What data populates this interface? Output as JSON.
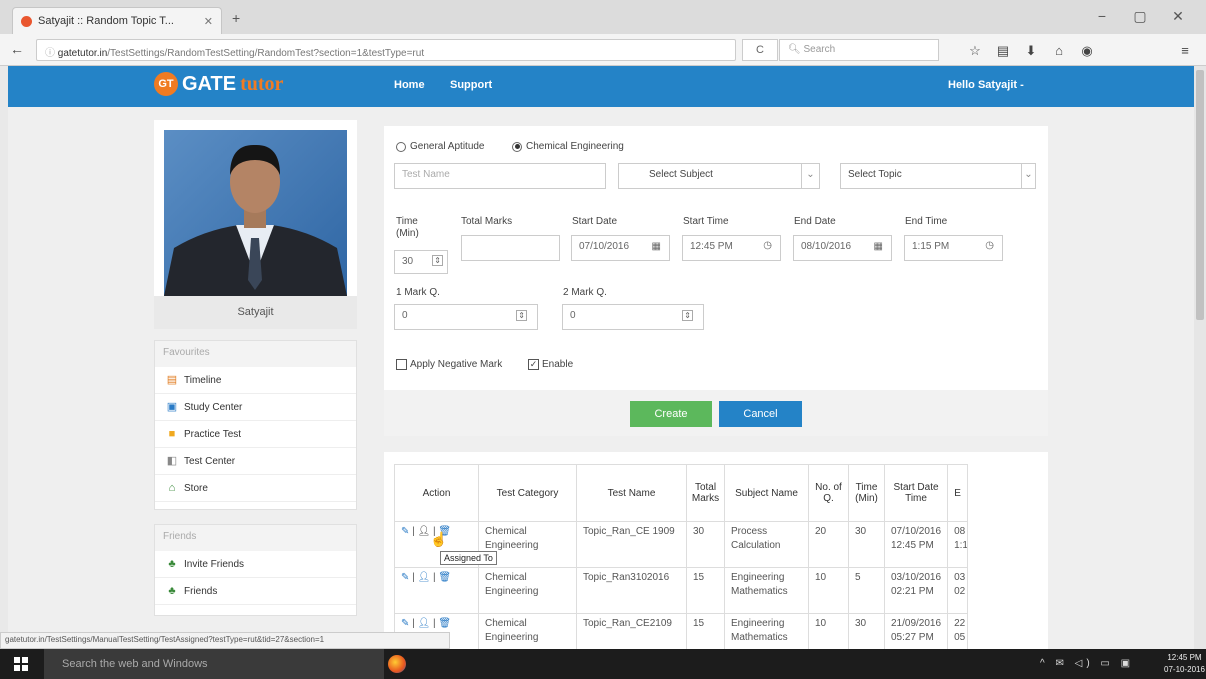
{
  "browser": {
    "tab_title": "Satyajit :: Random Topic T...",
    "tab_close": "✕",
    "new_tab": "+",
    "url_domain": "gatetutor.in",
    "url_path": "/TestSettings/RandomTestSetting/RandomTest?section=1&testType=rut",
    "reload": "C",
    "search_placeholder": "Search"
  },
  "site": {
    "logo_badge": "GT",
    "logo_gate": "GATE",
    "logo_tutor": "tutor",
    "nav_home": "Home",
    "nav_support": "Support",
    "greeting": "Hello Satyajit -"
  },
  "profile": {
    "name": "Satyajit"
  },
  "sidebar": {
    "favourites_title": "Favourites",
    "favourites": [
      {
        "label": "Timeline"
      },
      {
        "label": "Study Center"
      },
      {
        "label": "Practice Test"
      },
      {
        "label": "Test Center"
      },
      {
        "label": "Store"
      }
    ],
    "friends_title": "Friends",
    "friends": [
      {
        "label": "Invite Friends"
      },
      {
        "label": "Friends"
      }
    ]
  },
  "form": {
    "radio_general": "General Aptitude",
    "radio_chemical": "Chemical Engineering",
    "test_name_placeholder": "Test Name",
    "select_subject": "Select Subject",
    "select_topic": "Select Topic",
    "time_label": "Time (Min)",
    "time_value": "30",
    "total_marks_label": "Total Marks",
    "start_date_label": "Start Date",
    "start_date_value": "07/10/2016",
    "start_time_label": "Start Time",
    "start_time_value": "12:45 PM",
    "end_date_label": "End Date",
    "end_date_value": "08/10/2016",
    "end_time_label": "End Time",
    "end_time_value": "1:15 PM",
    "one_mark_label": "1 Mark Q.",
    "one_mark_value": "0",
    "two_mark_label": "2 Mark Q.",
    "two_mark_value": "0",
    "negative_mark_label": "Apply Negative Mark",
    "enable_label": "Enable",
    "create_button": "Create",
    "cancel_button": "Cancel"
  },
  "table": {
    "headers": [
      "Action",
      "Test Category",
      "Test Name",
      "Total Marks",
      "Subject Name",
      "No. of Q.",
      "Time (Min)",
      "Start Date Time",
      "E"
    ],
    "rows": [
      {
        "category": "Chemical Engineering",
        "name": "Topic_Ran_CE 1909",
        "marks": "30",
        "subject": "Process Calculation",
        "q": "20",
        "time": "30",
        "start": "07/10/2016 12:45 PM",
        "end": "08 1:1"
      },
      {
        "category": "Chemical Engineering",
        "name": "Topic_Ran3102016",
        "marks": "15",
        "subject": "Engineering Mathematics",
        "q": "10",
        "time": "5",
        "start": "03/10/2016 02:21 PM",
        "end": "03 02"
      },
      {
        "category": "Chemical Engineering",
        "name": "Topic_Ran_CE2109",
        "marks": "15",
        "subject": "Engineering Mathematics",
        "q": "10",
        "time": "30",
        "start": "21/09/2016 05:27 PM",
        "end": "22 05"
      }
    ],
    "tooltip": "Assigned To"
  },
  "status_url": "gatetutor.in/TestSettings/ManualTestSetting/TestAssigned?testType=rut&tid=27&section=1",
  "taskbar": {
    "search_placeholder": "Search the web and Windows",
    "time": "12:45 PM",
    "date": "07-10-2016"
  }
}
